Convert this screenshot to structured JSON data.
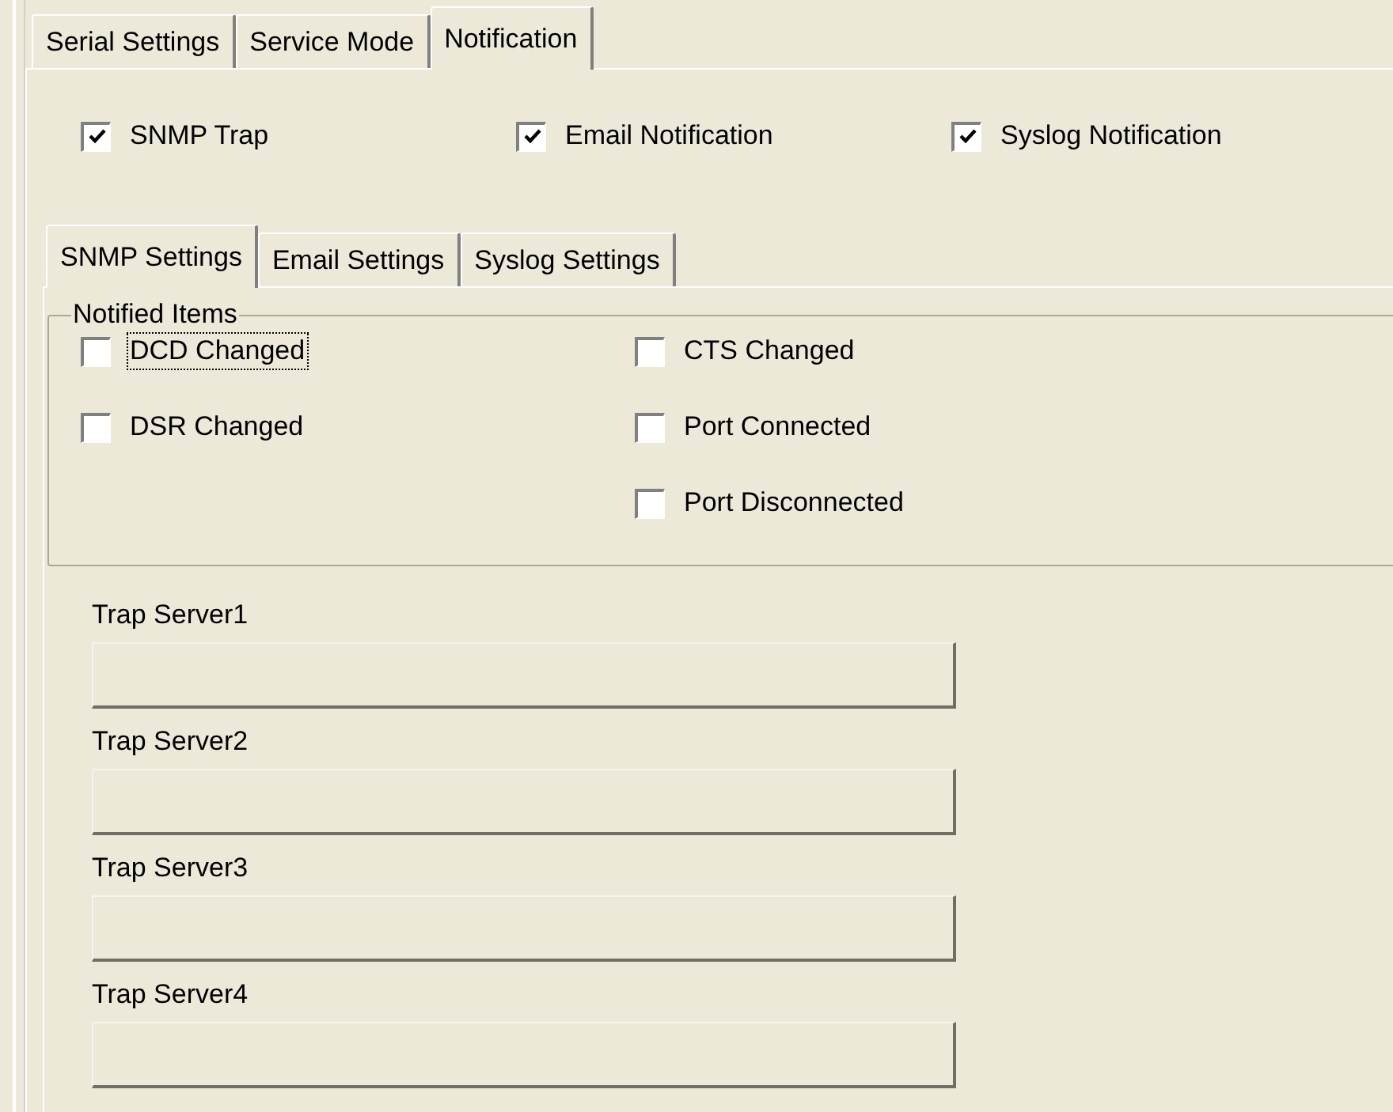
{
  "tabs": [
    {
      "label": "Serial Settings",
      "selected": false
    },
    {
      "label": "Service Mode",
      "selected": false
    },
    {
      "label": "Notification",
      "selected": true
    }
  ],
  "notifications": [
    {
      "label": "SNMP Trap",
      "checked": true
    },
    {
      "label": "Email Notification",
      "checked": true
    },
    {
      "label": "Syslog Notification",
      "checked": true
    }
  ],
  "sub_tabs": [
    {
      "label": "SNMP Settings",
      "selected": true
    },
    {
      "label": "Email Settings",
      "selected": false
    },
    {
      "label": "Syslog Settings",
      "selected": false
    }
  ],
  "notified_items": {
    "title": "Notified Items",
    "left": [
      {
        "label": "DCD Changed",
        "checked": false,
        "focused": true
      },
      {
        "label": "DSR Changed",
        "checked": false,
        "focused": false
      }
    ],
    "right": [
      {
        "label": "CTS Changed",
        "checked": false,
        "focused": false
      },
      {
        "label": "Port Connected",
        "checked": false,
        "focused": false
      },
      {
        "label": "Port Disconnected",
        "checked": false,
        "focused": false
      }
    ]
  },
  "trap_servers": [
    {
      "label": "Trap Server1",
      "disabled": true
    },
    {
      "label": "Trap Server2",
      "disabled": true
    },
    {
      "label": "Trap Server3",
      "disabled": true
    },
    {
      "label": "Trap Server4",
      "disabled": true
    }
  ]
}
